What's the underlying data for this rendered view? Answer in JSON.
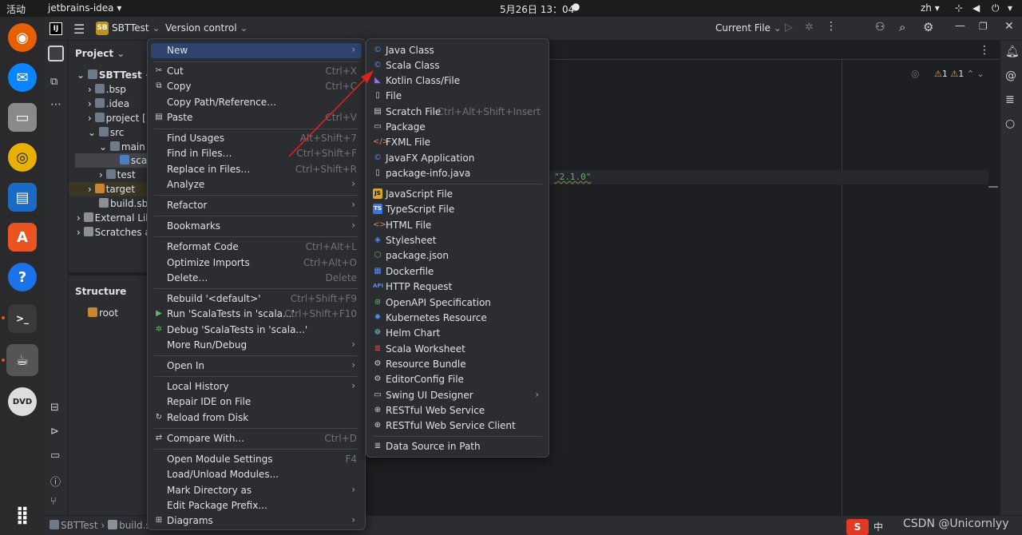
{
  "topbar": {
    "activities": "活动",
    "app": "jetbrains-idea ▾",
    "datetime": "5月26日  13：04",
    "lang": "zh ▾"
  },
  "header": {
    "project_badge": "SB",
    "project": "SBTTest",
    "vcs": "Version control",
    "run_config": "Current File"
  },
  "project_panel": {
    "title": "Project",
    "items": [
      {
        "label": "SBTTest ~/"
      },
      {
        "label": ".bsp"
      },
      {
        "label": ".idea"
      },
      {
        "label": "project ["
      },
      {
        "label": "src"
      },
      {
        "label": "main"
      },
      {
        "label": "sca"
      },
      {
        "label": "test"
      },
      {
        "label": "target"
      },
      {
        "label": "build.sbt"
      },
      {
        "label": "External Lib"
      },
      {
        "label": "Scratches a"
      }
    ]
  },
  "structure_panel": {
    "title": "Structure",
    "root": "root"
  },
  "editor": {
    "code_fragment": "\"2.1.0\"",
    "warn1": "1",
    "warn2": "1"
  },
  "status": {
    "crumb1": "SBTTest",
    "crumb2": "build.s",
    "watermark": "CSDN @Unicornlyy",
    "ime": "中"
  },
  "context_menu": {
    "items": [
      {
        "label": "New",
        "shortcut": "",
        "arrow": true
      },
      {
        "label": "Cut",
        "shortcut": "Ctrl+X"
      },
      {
        "label": "Copy",
        "shortcut": "Ctrl+C"
      },
      {
        "label": "Copy Path/Reference…",
        "shortcut": ""
      },
      {
        "label": "Paste",
        "shortcut": "Ctrl+V"
      },
      {
        "label": "Find Usages",
        "shortcut": "Alt+Shift+7"
      },
      {
        "label": "Find in Files…",
        "shortcut": "Ctrl+Shift+F"
      },
      {
        "label": "Replace in Files…",
        "shortcut": "Ctrl+Shift+R"
      },
      {
        "label": "Analyze",
        "shortcut": "",
        "arrow": true
      },
      {
        "label": "Refactor",
        "shortcut": "",
        "arrow": true
      },
      {
        "label": "Bookmarks",
        "shortcut": "",
        "arrow": true
      },
      {
        "label": "Reformat Code",
        "shortcut": "Ctrl+Alt+L"
      },
      {
        "label": "Optimize Imports",
        "shortcut": "Ctrl+Alt+O"
      },
      {
        "label": "Delete…",
        "shortcut": "Delete"
      },
      {
        "label": "Rebuild '<default>'",
        "shortcut": "Ctrl+Shift+F9"
      },
      {
        "label": "Run 'ScalaTests in 'scala...'",
        "shortcut": "Ctrl+Shift+F10"
      },
      {
        "label": "Debug 'ScalaTests in 'scala...'",
        "shortcut": ""
      },
      {
        "label": "More Run/Debug",
        "shortcut": "",
        "arrow": true
      },
      {
        "label": "Open In",
        "shortcut": "",
        "arrow": true
      },
      {
        "label": "Local History",
        "shortcut": "",
        "arrow": true
      },
      {
        "label": "Repair IDE on File",
        "shortcut": ""
      },
      {
        "label": "Reload from Disk",
        "shortcut": ""
      },
      {
        "label": "Compare With...",
        "shortcut": "Ctrl+D"
      },
      {
        "label": "Open Module Settings",
        "shortcut": "F4"
      },
      {
        "label": "Load/Unload Modules...",
        "shortcut": ""
      },
      {
        "label": "Mark Directory as",
        "shortcut": "",
        "arrow": true
      },
      {
        "label": "Edit Package Prefix...",
        "shortcut": ""
      },
      {
        "label": "Diagrams",
        "shortcut": "",
        "arrow": true
      }
    ]
  },
  "new_submenu": {
    "items": [
      {
        "label": "Java Class",
        "shortcut": ""
      },
      {
        "label": "Scala Class",
        "shortcut": ""
      },
      {
        "label": "Kotlin Class/File",
        "shortcut": ""
      },
      {
        "label": "File",
        "shortcut": ""
      },
      {
        "label": "Scratch File",
        "shortcut": "Ctrl+Alt+Shift+Insert"
      },
      {
        "label": "Package",
        "shortcut": ""
      },
      {
        "label": "FXML File",
        "shortcut": ""
      },
      {
        "label": "JavaFX Application",
        "shortcut": ""
      },
      {
        "label": "package-info.java",
        "shortcut": ""
      },
      {
        "label": "JavaScript File",
        "shortcut": ""
      },
      {
        "label": "TypeScript File",
        "shortcut": ""
      },
      {
        "label": "HTML File",
        "shortcut": ""
      },
      {
        "label": "Stylesheet",
        "shortcut": ""
      },
      {
        "label": "package.json",
        "shortcut": ""
      },
      {
        "label": "Dockerfile",
        "shortcut": ""
      },
      {
        "label": "HTTP Request",
        "shortcut": ""
      },
      {
        "label": "OpenAPI Specification",
        "shortcut": ""
      },
      {
        "label": "Kubernetes Resource",
        "shortcut": ""
      },
      {
        "label": "Helm Chart",
        "shortcut": ""
      },
      {
        "label": "Scala Worksheet",
        "shortcut": ""
      },
      {
        "label": "Resource Bundle",
        "shortcut": ""
      },
      {
        "label": "EditorConfig File",
        "shortcut": ""
      },
      {
        "label": "Swing UI Designer",
        "shortcut": "",
        "arrow": true
      },
      {
        "label": "RESTful Web Service",
        "shortcut": ""
      },
      {
        "label": "RESTful Web Service Client",
        "shortcut": ""
      },
      {
        "label": "Data Source in Path",
        "shortcut": ""
      }
    ]
  },
  "colors": {
    "selection": "#2e436e",
    "accent": "#3574f0",
    "annotation_arrow": "#e02020"
  }
}
